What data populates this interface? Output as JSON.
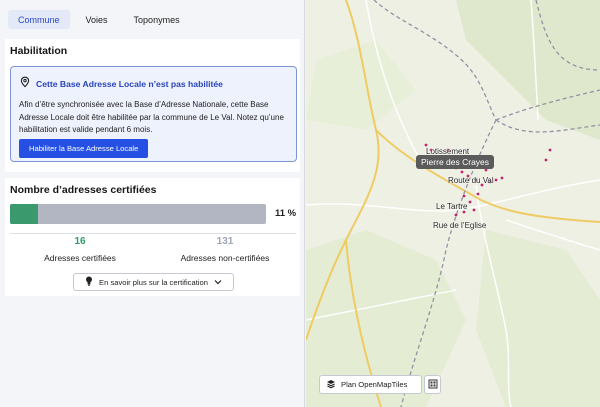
{
  "tabs": [
    {
      "label": "Commune",
      "active": true
    },
    {
      "label": "Voies",
      "active": false
    },
    {
      "label": "Toponymes",
      "active": false
    }
  ],
  "habilitation": {
    "title": "Habilitation",
    "alert_title": "Cette Base Adresse Locale n’est pas habilitée",
    "alert_body": "Afin d’être synchronisée avec la Base d’Adresse Nationale, cette Base Adresse Locale doit être habilitée par la commune de Le Val. Notez qu’une habilitation est valide pendant 6 mois.",
    "button_label": "Habiliter la Base Adresse Locale"
  },
  "certification": {
    "title": "Nombre d’adresses certifiées",
    "progress_fraction": 0.11,
    "percent_label": "11 %",
    "certified_count": "16",
    "certified_label": "Adresses certifiées",
    "uncertified_count": "131",
    "uncertified_label": "Adresses non-certifiées",
    "learn_more_label": "En savoir plus sur la certification"
  },
  "map": {
    "labels": {
      "lotissement": "Lotissement",
      "route_du_val": "Route du Val",
      "le_tartre": "Le Tartre",
      "rue_eglise": "Rue de l’Eglise"
    },
    "tooltip": "Pierre des Crayes",
    "style_label": "Plan OpenMapTiles"
  },
  "colors": {
    "accent": "#2650e3",
    "certified": "#3a9a6d",
    "uncertified": "#b1b6c2",
    "road_major": "#f2d26b",
    "border_dash": "#8f93a3",
    "address_marker": "#c0246a"
  }
}
